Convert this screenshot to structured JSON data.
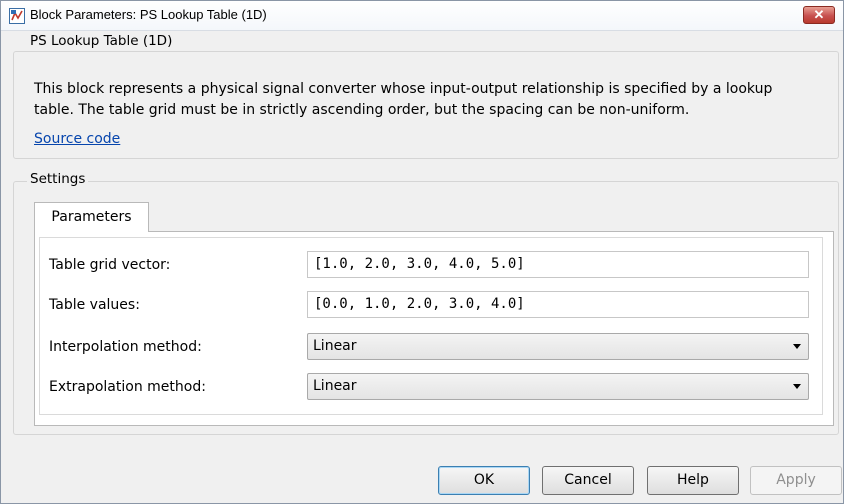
{
  "window": {
    "title": "Block Parameters: PS Lookup Table (1D)",
    "close_glyph": "✕"
  },
  "description": {
    "legend": "PS Lookup Table (1D)",
    "text": "This block represents a physical signal converter whose input-output relationship is specified by a lookup table. The table grid must be in strictly ascending order, but the spacing can be non-uniform.",
    "link": "Source code"
  },
  "settings": {
    "legend": "Settings",
    "tab_label": "Parameters",
    "fields": {
      "grid_label": "Table grid vector:",
      "grid_value": "[1.0, 2.0, 3.0, 4.0, 5.0]",
      "values_label": "Table values:",
      "values_value": "[0.0, 1.0, 2.0, 3.0, 4.0]",
      "interp_label": "Interpolation method:",
      "interp_value": "Linear",
      "extrap_label": "Extrapolation method:",
      "extrap_value": "Linear"
    }
  },
  "buttons": {
    "ok": "OK",
    "cancel": "Cancel",
    "help": "Help",
    "apply": "Apply"
  },
  "colors": {
    "link": "#0645ad",
    "close_button": "#c75050",
    "dialog_bg": "#f0f0f0"
  },
  "icons": {
    "app": "simulink-block-icon",
    "dropdown": "chevron-down-icon",
    "close": "close-icon"
  }
}
